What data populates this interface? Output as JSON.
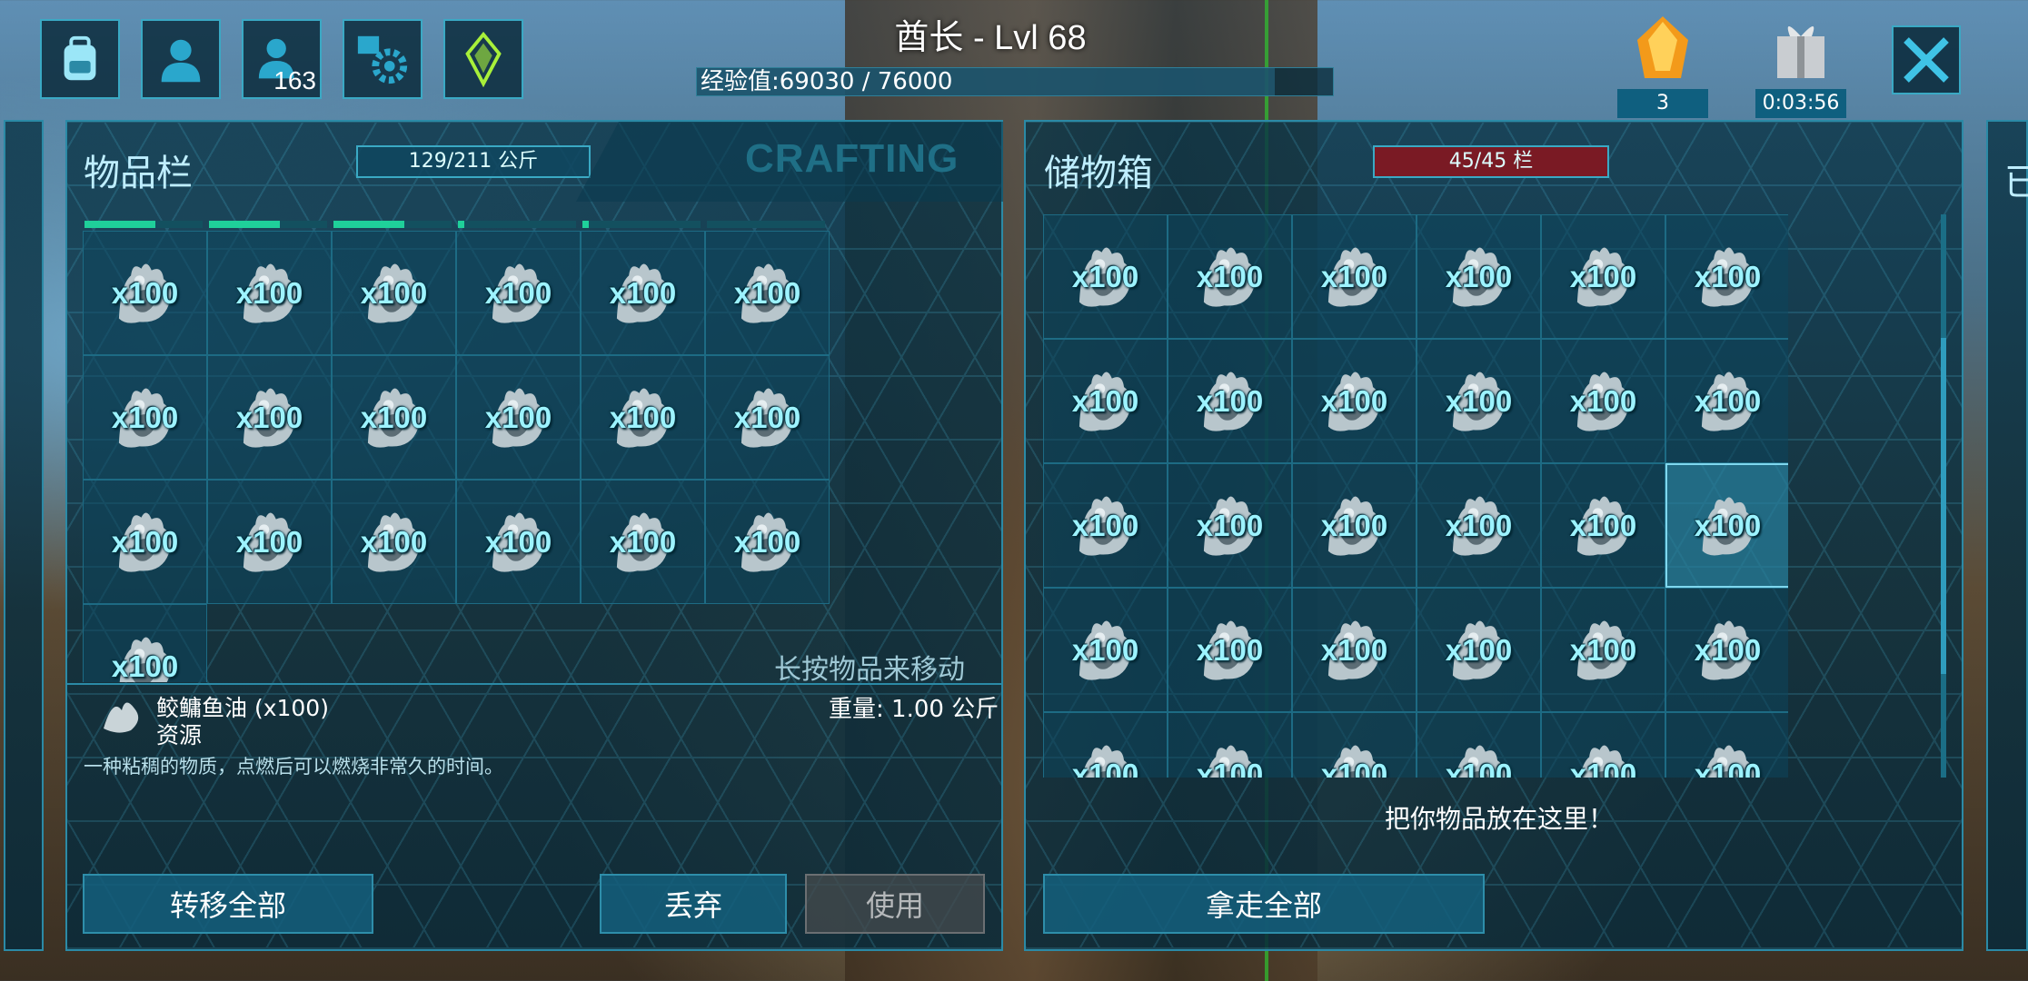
{
  "header": {
    "title": "酋长 - Lvl 68",
    "xp_label": "经验值:69030 / 76000",
    "xp_fraction": 0.908,
    "social_count": "163"
  },
  "resources": {
    "element_count": "3",
    "gift_timer": "0:03:56"
  },
  "inventory": {
    "title": "物品栏",
    "weight": "129/211 公斤",
    "crafting_tab": "CRAFTING",
    "hint": "长按物品来移动",
    "item_qty": "x100",
    "slot_count": 19,
    "durability": [
      0.6,
      0.6,
      0.6,
      0.05,
      0.05,
      0.0
    ],
    "selected_item": {
      "name": "鲛鳙鱼油 (x100)",
      "category": "资源",
      "weight": "重量: 1.00 公斤",
      "description": "一种粘稠的物质，点燃后可以燃烧非常久的时间。"
    },
    "buttons": {
      "transfer_all": "转移全部",
      "drop": "丢弃",
      "use": "使用"
    }
  },
  "storage": {
    "title": "储物箱",
    "capacity": "45/45 栏",
    "item_qty": "x100",
    "drop_hint": "把你物品放在这里！",
    "buttons": {
      "take_all": "拿走全部"
    },
    "selected_slot": 17
  },
  "colors": {
    "accent": "#3aa9c4",
    "qty_text": "#9df3ff",
    "capacity_full": "#7a1a24",
    "durability": "#1fd09a"
  }
}
